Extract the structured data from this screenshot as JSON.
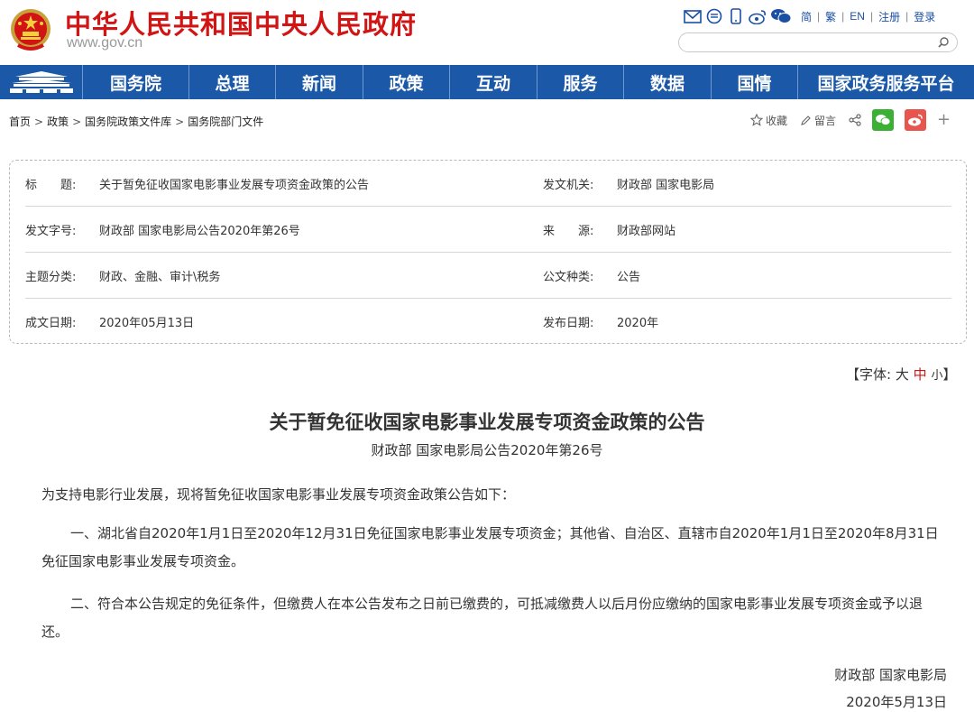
{
  "header": {
    "site_title": "中华人民共和国中央人民政府",
    "site_url": "www.gov.cn",
    "top_links": [
      "简",
      "繁",
      "EN",
      "注册",
      "登录"
    ],
    "search_placeholder": ""
  },
  "nav": {
    "items": [
      "国务院",
      "总理",
      "新闻",
      "政策",
      "互动",
      "服务",
      "数据",
      "国情",
      "国家政务服务平台"
    ]
  },
  "breadcrumb": {
    "items": [
      "首页",
      "政策",
      "国务院政策文件库",
      "国务院部门文件"
    ],
    "separator": ">"
  },
  "share": {
    "favorite": "收藏",
    "comment": "留言"
  },
  "info": {
    "rows": [
      {
        "left_label": "标　　题:",
        "left_value": "关于暂免征收国家电影事业发展专项资金政策的公告",
        "right_label": "发文机关:",
        "right_value": "财政部 国家电影局"
      },
      {
        "left_label": "发文字号:",
        "left_value": "财政部 国家电影局公告2020年第26号",
        "right_label": "来　　源:",
        "right_value": "财政部网站"
      },
      {
        "left_label": "主题分类:",
        "left_value": "财政、金融、审计\\税务",
        "right_label": "公文种类:",
        "right_value": "公告"
      },
      {
        "left_label": "成文日期:",
        "left_value": "2020年05月13日",
        "right_label": "发布日期:",
        "right_value": "2020年"
      }
    ]
  },
  "font_size": {
    "open": "【字体:",
    "large": "大",
    "medium": "中",
    "small": "小",
    "close": "】"
  },
  "article": {
    "title": "关于暂免征收国家电影事业发展专项资金政策的公告",
    "subtitle": "财政部 国家电影局公告2020年第26号",
    "paragraphs": [
      "为支持电影行业发展，现将暂免征收国家电影事业发展专项资金政策公告如下：",
      "一、湖北省自2020年1月1日至2020年12月31日免征国家电影事业发展专项资金；其他省、自治区、直辖市自2020年1月1日至2020年8月31日免征国家电影事业发展专项资金。",
      "二、符合本公告规定的免征条件，但缴费人在本公告发布之日前已缴费的，可抵减缴费人以后月份应缴纳的国家电影事业发展专项资金或予以退还。"
    ],
    "signature": "财政部 国家电影局",
    "date": "2020年5月13日"
  },
  "colors": {
    "brand_red": "#d11414",
    "nav_blue": "#1b59a8",
    "link_blue": "#1b4fa4",
    "wechat_green": "#3cb034",
    "weibo_red": "#e8544e"
  },
  "icons": [
    "emblem-icon",
    "email-icon",
    "message-icon",
    "mobile-icon",
    "weibo-icon",
    "wechat-icon",
    "search-icon",
    "star-icon",
    "pen-icon",
    "share-icon",
    "plus-icon",
    "tiananmen-icon"
  ]
}
